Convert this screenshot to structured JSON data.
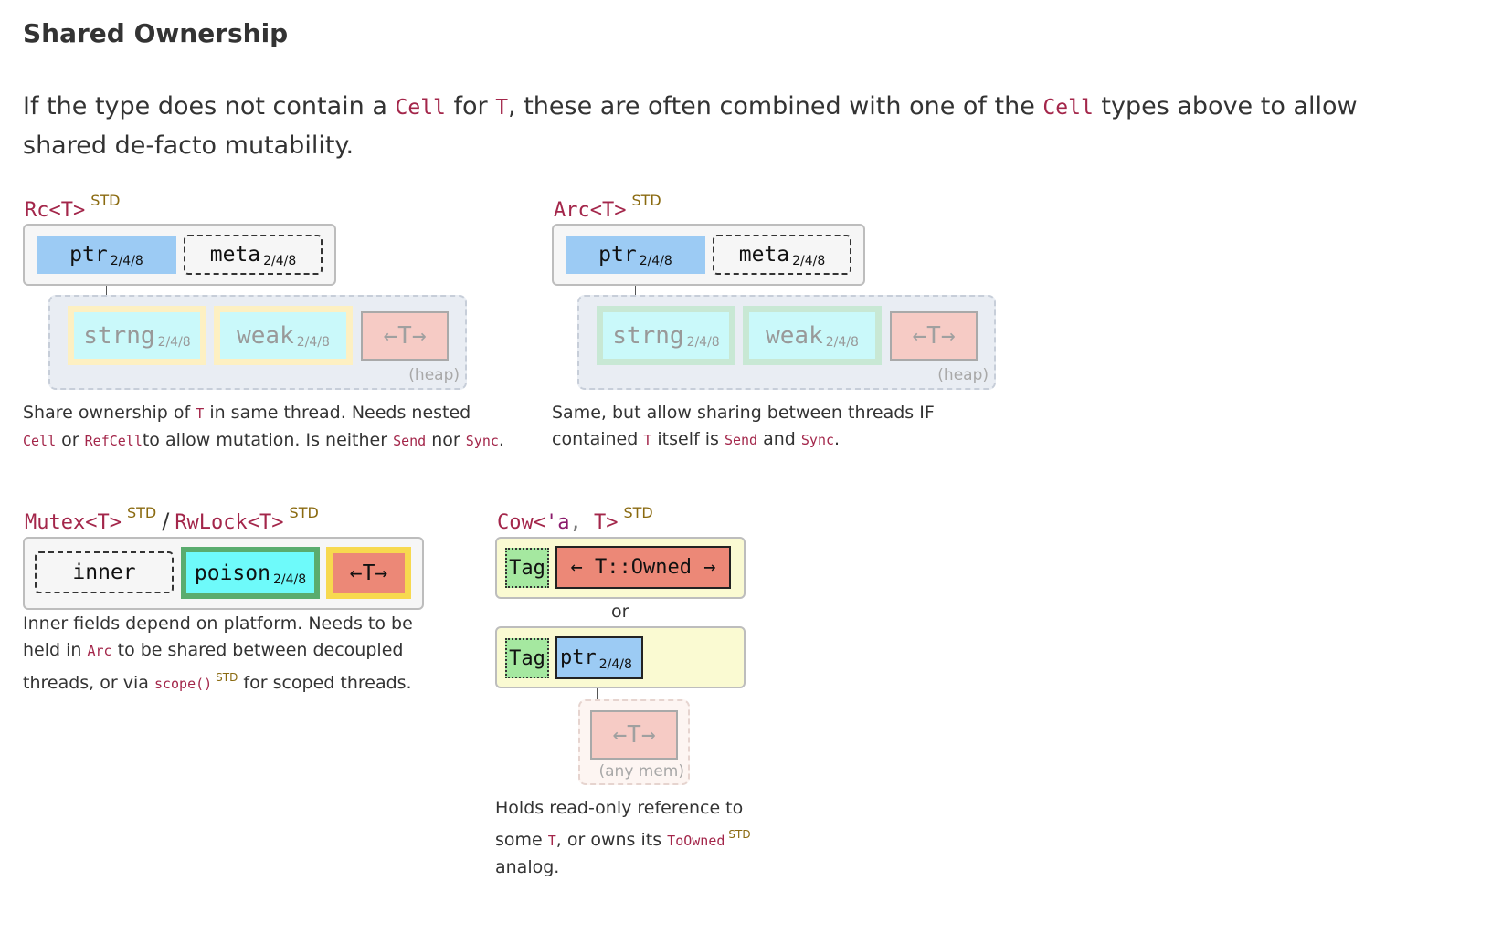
{
  "section": {
    "title": "Shared Ownership",
    "intro": {
      "t1": "If the type does not contain a ",
      "c1": "Cell",
      "t2": " for ",
      "c2": "T",
      "t3": ", these are often combined with one of the ",
      "c3": "Cell",
      "t4": " types above to allow shared de-facto mutability."
    }
  },
  "badge": "STD",
  "size_label": "2/4/8",
  "heap_label": "(heap)",
  "t_arrow": "←T→",
  "rc": {
    "heading": "Rc<T>",
    "ptr": "ptr",
    "meta": "meta",
    "strng": "strng",
    "weak": "weak",
    "desc": {
      "t1": "Share ownership of ",
      "c1": "T",
      "t2": " in same thread. Needs nested ",
      "c2": "Cell",
      "t3": " or ",
      "c3": "RefCell",
      "t4": "to allow mutation. Is neither ",
      "c4": "Send",
      "t5": " nor ",
      "c5": "Sync",
      "t6": "."
    }
  },
  "arc": {
    "heading": "Arc<T>",
    "ptr": "ptr",
    "meta": "meta",
    "strng": "strng",
    "weak": "weak",
    "desc": {
      "t1": "Same, but allow sharing between threads IF contained ",
      "c1": "T",
      "t2": " itself is ",
      "c2": "Send",
      "t3": " and ",
      "c3": "Sync",
      "t4": "."
    }
  },
  "mutex": {
    "heading1": "Mutex<T>",
    "separator": "/",
    "heading2": "RwLock<T>",
    "inner": "inner",
    "poison": "poison",
    "desc": {
      "t1": "Inner fields depend on platform. Needs to be held in ",
      "c1": "Arc",
      "t2": " to be shared between decoupled threads, or via ",
      "c2": "scope()",
      "t3": " for scoped threads."
    }
  },
  "cow": {
    "heading_a": "Cow<",
    "heading_lt": "'a",
    "heading_comma": ",",
    "heading_b": " T>",
    "tag": "Tag",
    "owned": "← T::Owned →",
    "or": "or",
    "ptr": "ptr",
    "any_mem": "(any mem)",
    "desc": {
      "t1": "Holds read-only reference to some ",
      "c1": "T",
      "t2": ", or owns its ",
      "c2": "ToOwned",
      "t3": " analog."
    }
  }
}
